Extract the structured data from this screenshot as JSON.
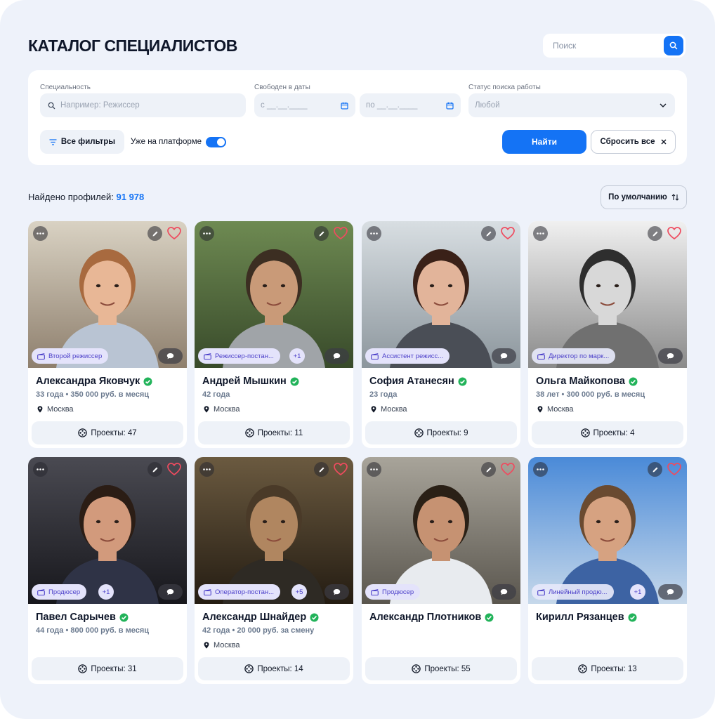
{
  "header": {
    "title": "КАТАЛОГ СПЕЦИАЛИСТОВ",
    "search_placeholder": "Поиск"
  },
  "filters": {
    "specialty_label": "Специальность",
    "specialty_placeholder": "Например: Режиссер",
    "dates_label": "Свободен в даты",
    "date_from_placeholder": "с  __.__.____",
    "date_to_placeholder": "по  __.__.____",
    "status_label": "Статус поиска работы",
    "status_value": "Любой",
    "all_filters_label": "Все фильтры",
    "on_platform_label": "Уже на платформе",
    "find_label": "Найти",
    "reset_label": "Сбросить все"
  },
  "results": {
    "found_prefix": "Найдено профилей:",
    "count": "91 978",
    "sort_label": "По умолчанию"
  },
  "accent_color": "#1473f5",
  "cards": [
    {
      "name": "Александра Яковчук",
      "tag": "Второй режиссер",
      "tag_extra": "",
      "meta": "33 года  •  350 000 руб. в месяц",
      "city": "Москва",
      "projects": "Проекты:  47"
    },
    {
      "name": "Андрей Мышкин",
      "tag": "Режиссер-постан...",
      "tag_extra": "+1",
      "meta": "42 года",
      "city": "Москва",
      "projects": "Проекты:  11"
    },
    {
      "name": "София Атанесян",
      "tag": "Ассистент режисс...",
      "tag_extra": "",
      "meta": "23 года",
      "city": "Москва",
      "projects": "Проекты:  9"
    },
    {
      "name": "Ольга Майкопова",
      "tag": "Директор по марк...",
      "tag_extra": "",
      "meta": "38 лет  •  300 000 руб. в месяц",
      "city": "Москва",
      "projects": "Проекты:  4"
    },
    {
      "name": "Павел Сарычев",
      "tag": "Продюсер",
      "tag_extra": "+1",
      "meta": "44 года  •  800 000 руб. в месяц",
      "city": "",
      "projects": "Проекты:  31"
    },
    {
      "name": "Александр Шнайдер",
      "tag": "Оператор-постан...",
      "tag_extra": "+5",
      "meta": "42 года  •  20 000 руб. за смену",
      "city": "Москва",
      "projects": "Проекты:  14"
    },
    {
      "name": "Александр Плотников",
      "tag": "Продюсер",
      "tag_extra": "",
      "meta": "",
      "city": "",
      "projects": "Проекты:  55"
    },
    {
      "name": "Кирилл Рязанцев",
      "tag": "Линейный продю...",
      "tag_extra": "+1",
      "meta": "",
      "city": "",
      "projects": "Проекты:  13"
    }
  ]
}
